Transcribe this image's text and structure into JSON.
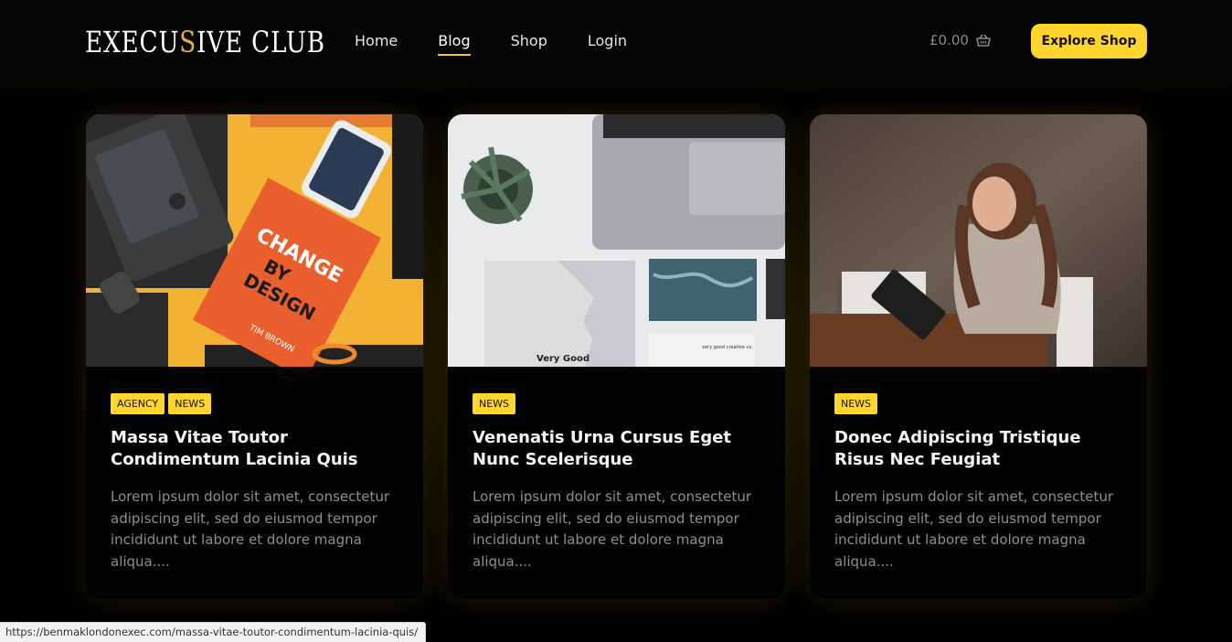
{
  "brand": {
    "logo_part1": "EXECU",
    "logo_accent": "S",
    "logo_part2": "IVE CLUB"
  },
  "nav": [
    {
      "label": "Home",
      "active": false
    },
    {
      "label": "Blog",
      "active": true
    },
    {
      "label": "Shop",
      "active": false
    },
    {
      "label": "Login",
      "active": false
    }
  ],
  "cart": {
    "total": "£0.00",
    "icon": "basket-icon"
  },
  "cta": {
    "label": "Explore Shop"
  },
  "colors": {
    "accent": "#ffd52e",
    "background": "#000000",
    "excerpt": "#8e8e8e"
  },
  "posts": [
    {
      "tags": [
        "AGENCY",
        "NEWS"
      ],
      "title": "Massa Vitae Toutor Condimentum Lacinia Quis",
      "excerpt": "Lorem ipsum dolor sit amet, consectetur adipiscing elit, sed do eiusmod tempor incididunt ut labore et dolore magna aliqua....",
      "image": {
        "subject": "flat-lay-design-book-photo",
        "book_line1": "CHANGE",
        "book_line2": "BY",
        "book_line3": "DESIGN",
        "book_author": "TIM BROWN"
      }
    },
    {
      "tags": [
        "NEWS"
      ],
      "title": "Venenatis Urna Cursus Eget Nunc Scelerisque",
      "excerpt": "Lorem ipsum dolor sit amet, consectetur adipiscing elit, sed do eiusmod tempor incididunt ut labore et dolore magna aliqua....",
      "image": {
        "subject": "laptop-plant-desk-photo",
        "paper_text": "Very Good",
        "small_card_text": "very good creative co."
      }
    },
    {
      "tags": [
        "NEWS"
      ],
      "title": "Donec Adipiscing Tristique Risus Nec Feugiat",
      "excerpt": "Lorem ipsum dolor sit amet, consectetur adipiscing elit, sed do eiusmod tempor incididunt ut labore et dolore magna aliqua....",
      "image": {
        "subject": "woman-with-tablet-cafe-photo"
      }
    }
  ],
  "status_url": "https://benmaklondonexec.com/massa-vitae-toutor-condimentum-lacinia-quis/"
}
